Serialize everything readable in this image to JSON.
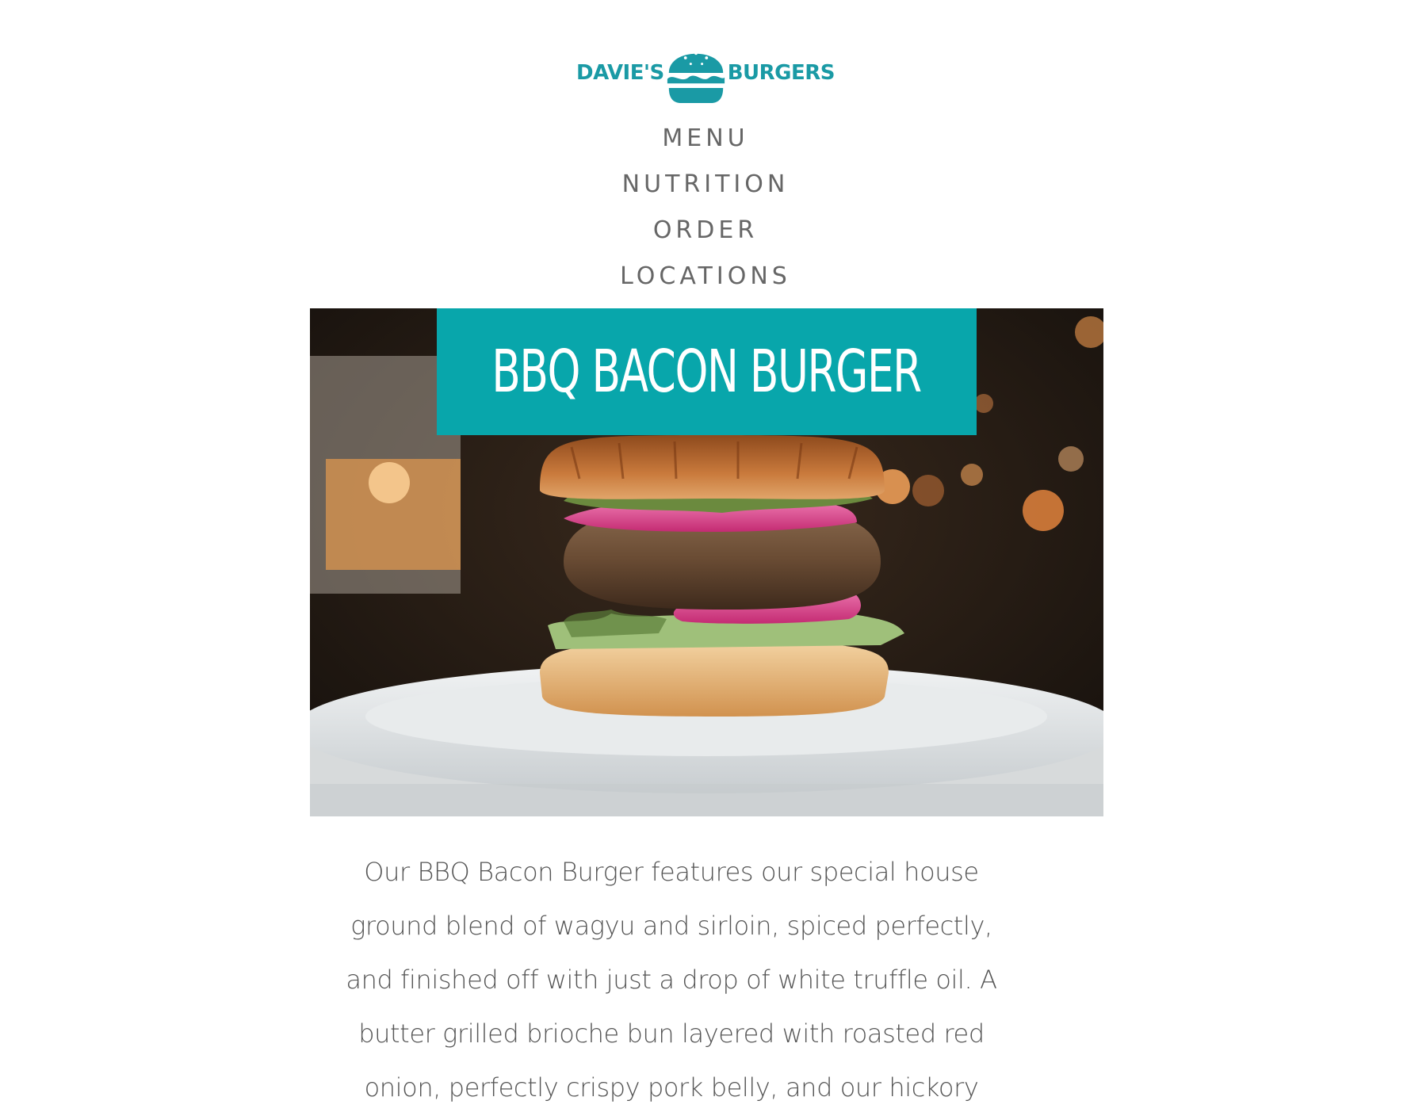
{
  "brand": {
    "name_left": "DAVIE'S",
    "name_right": "BURGERS",
    "icon": "burger-logo-icon",
    "color": "#1a9aa5"
  },
  "nav": {
    "items": [
      {
        "label": "MENU"
      },
      {
        "label": "NUTRITION"
      },
      {
        "label": "ORDER"
      },
      {
        "label": "LOCATIONS"
      }
    ]
  },
  "hero": {
    "title": "BBQ BACON BURGER",
    "title_bg": "#08a6ab",
    "image": "burger-photo"
  },
  "content": {
    "description": "Our BBQ Bacon Burger features our special house ground blend of wagyu and sirloin, spiced perfectly, and finished off with just a drop of white truffle oil. A butter grilled brioche bun layered with roasted red onion, perfectly crispy pork belly, and our hickory"
  }
}
